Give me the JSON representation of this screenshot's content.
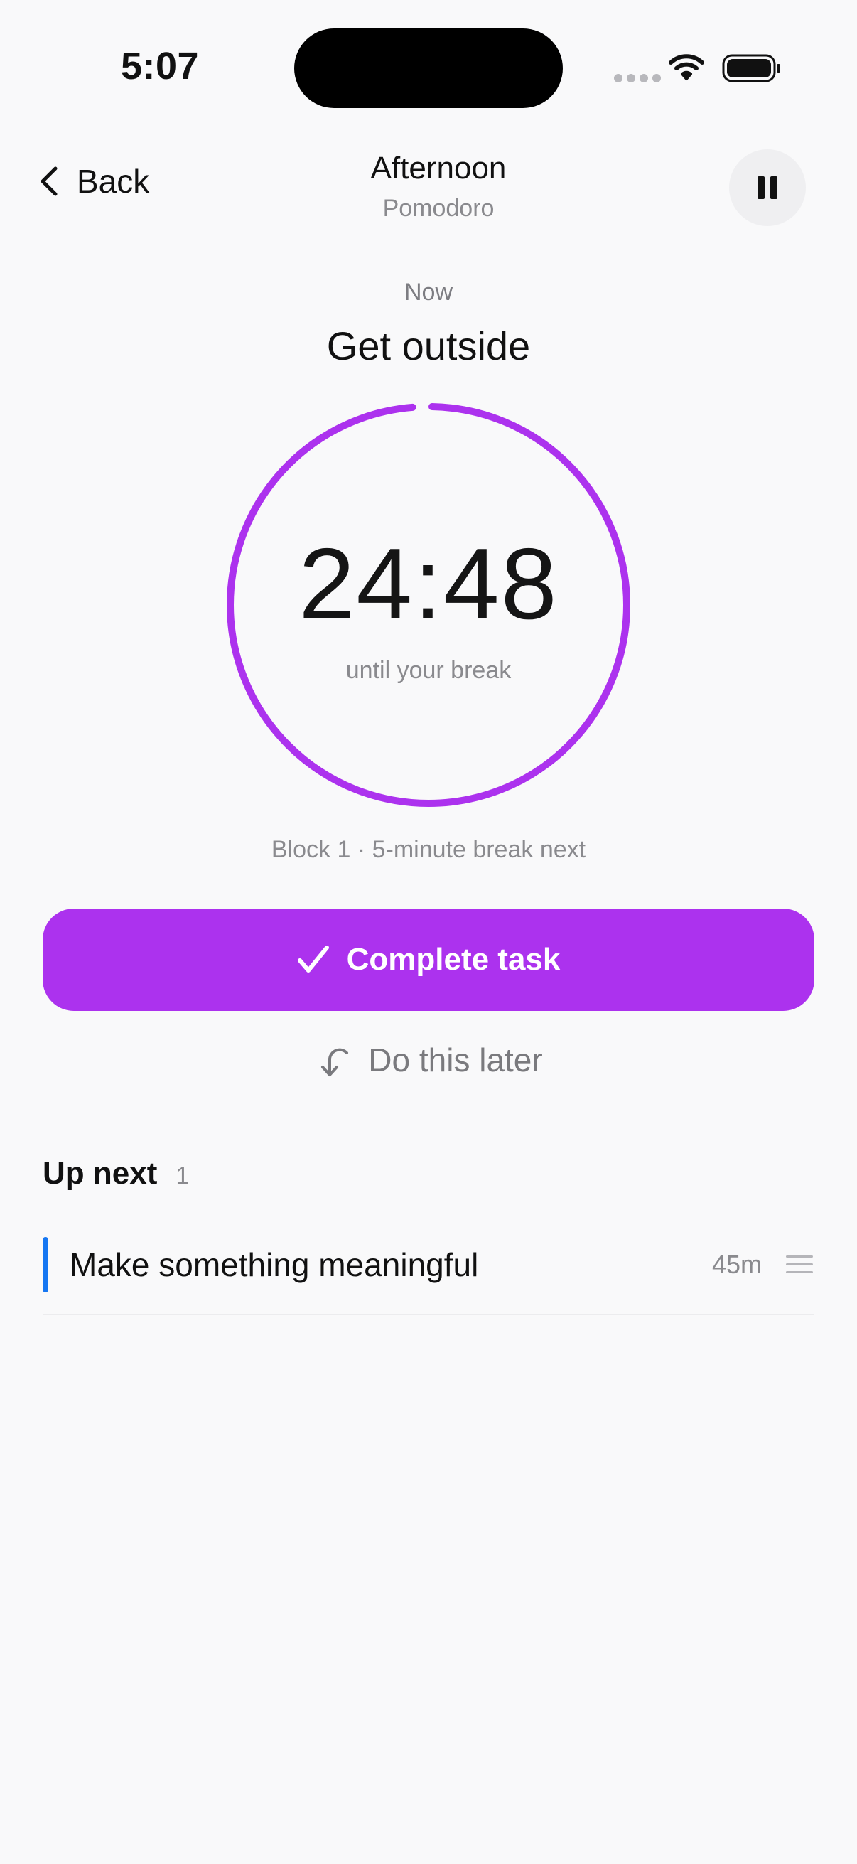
{
  "status_bar": {
    "time": "5:07",
    "icons": [
      "cellular-icon",
      "wifi-icon",
      "battery-icon"
    ]
  },
  "nav": {
    "back_label": "Back",
    "title": "Afternoon",
    "subtitle": "Pomodoro",
    "pause_icon": "pause-icon"
  },
  "current": {
    "now_label": "Now",
    "task_title": "Get outside",
    "timer": "24:48",
    "timer_caption": "until your break",
    "block_info": "Block 1 · 5-minute break next",
    "progress_fraction": 0.99
  },
  "actions": {
    "complete_label": "Complete task",
    "complete_icon": "checkmark-icon",
    "later_label": "Do this later",
    "later_icon": "defer-arrow-icon"
  },
  "up_next": {
    "title": "Up next",
    "count": "1",
    "items": [
      {
        "title": "Make something meaningful",
        "duration": "45m",
        "color": "#1677f2"
      }
    ]
  },
  "colors": {
    "accent": "#ac32ee",
    "background": "#f9f9fa",
    "item_marker": "#1677f2"
  }
}
